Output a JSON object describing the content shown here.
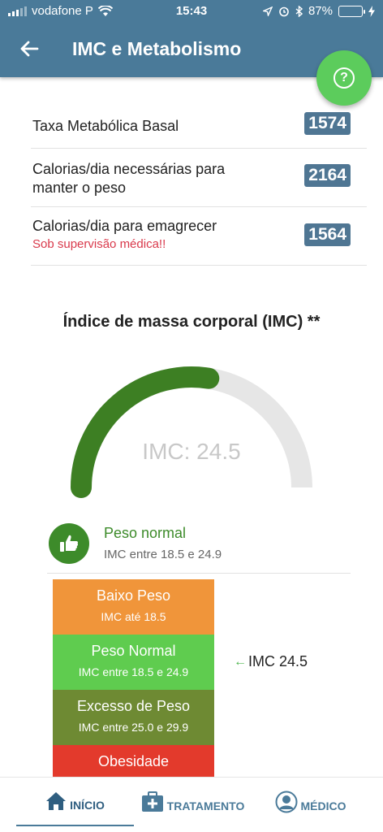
{
  "status_bar": {
    "carrier": "vodafone P",
    "time": "15:43",
    "battery_percent": "87%",
    "battery_level": 0.87
  },
  "header": {
    "title": "IMC e Metabolismo"
  },
  "metrics": [
    {
      "label": "Taxa Metabólica Basal",
      "value": "1574"
    },
    {
      "label": "Calorias/dia necessárias para manter o peso",
      "value": "2164"
    },
    {
      "label": "Calorias/dia para emagrecer",
      "note": "Sob supervisão médica!!",
      "value": "1564"
    }
  ],
  "imc_section": {
    "title": "Índice de massa corporal (IMC) **",
    "gauge_label": "IMC: 24.5",
    "gauge_fraction": 0.55,
    "status_title": "Peso normal",
    "status_sub": "IMC entre 18.5 e 24.9",
    "pointer_label": "IMC 24.5"
  },
  "scale": [
    {
      "title": "Baixo Peso",
      "sub": "IMC até 18.5"
    },
    {
      "title": "Peso Normal",
      "sub": "IMC entre 18.5 e 24.9"
    },
    {
      "title": "Excesso de Peso",
      "sub": "IMC entre 25.0 e 29.9"
    },
    {
      "title": "Obesidade",
      "sub": ""
    }
  ],
  "colors": {
    "header": "#4a7a99",
    "gauge_fill": "#3d7f23",
    "gauge_track": "#e6e6e6",
    "fab": "#5ccc5c"
  },
  "nav": [
    {
      "label": "INÍCIO",
      "icon": "home-icon",
      "active": true
    },
    {
      "label": "TRATAMENTO",
      "icon": "medical-kit-icon",
      "active": false
    },
    {
      "label": "MÉDICO",
      "icon": "doctor-icon",
      "active": false
    }
  ]
}
